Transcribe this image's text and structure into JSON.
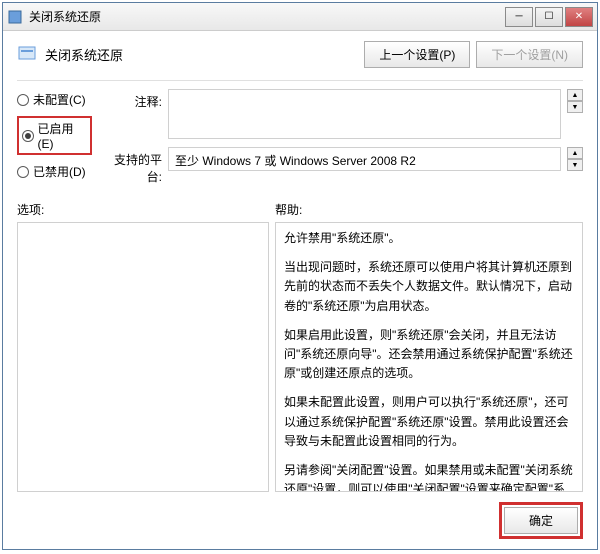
{
  "window": {
    "title": "关闭系统还原"
  },
  "header": {
    "title": "关闭系统还原",
    "prev_button": "上一个设置(P)",
    "next_button": "下一个设置(N)"
  },
  "radios": {
    "not_configured": "未配置(C)",
    "enabled": "已启用(E)",
    "disabled": "已禁用(D)"
  },
  "form": {
    "comment_label": "注释:",
    "platform_label": "支持的平台:",
    "platform_value": "至少 Windows 7 或 Windows Server 2008 R2"
  },
  "panes": {
    "options_label": "选项:",
    "help_label": "帮助:"
  },
  "help": {
    "p1": "允许禁用\"系统还原\"。",
    "p2": "当出现问题时，系统还原可以使用户将其计算机还原到先前的状态而不丢失个人数据文件。默认情况下，启动卷的\"系统还原\"为启用状态。",
    "p3": "如果启用此设置，则\"系统还原\"会关闭，并且无法访问\"系统还原向导\"。还会禁用通过系统保护配置\"系统还原\"或创建还原点的选项。",
    "p4": "如果未配置此设置，则用户可以执行\"系统还原\"，还可以通过系统保护配置\"系统还原\"设置。禁用此设置还会导致与未配置此设置相同的行为。",
    "p5": "另请参阅\"关闭配置\"设置。如果禁用或未配置\"关闭系统还原\"设置，则可以使用\"关闭配置\"设置来确定配置\"系统还原\"的选项是否可用。"
  },
  "footer": {
    "ok": "确定"
  }
}
